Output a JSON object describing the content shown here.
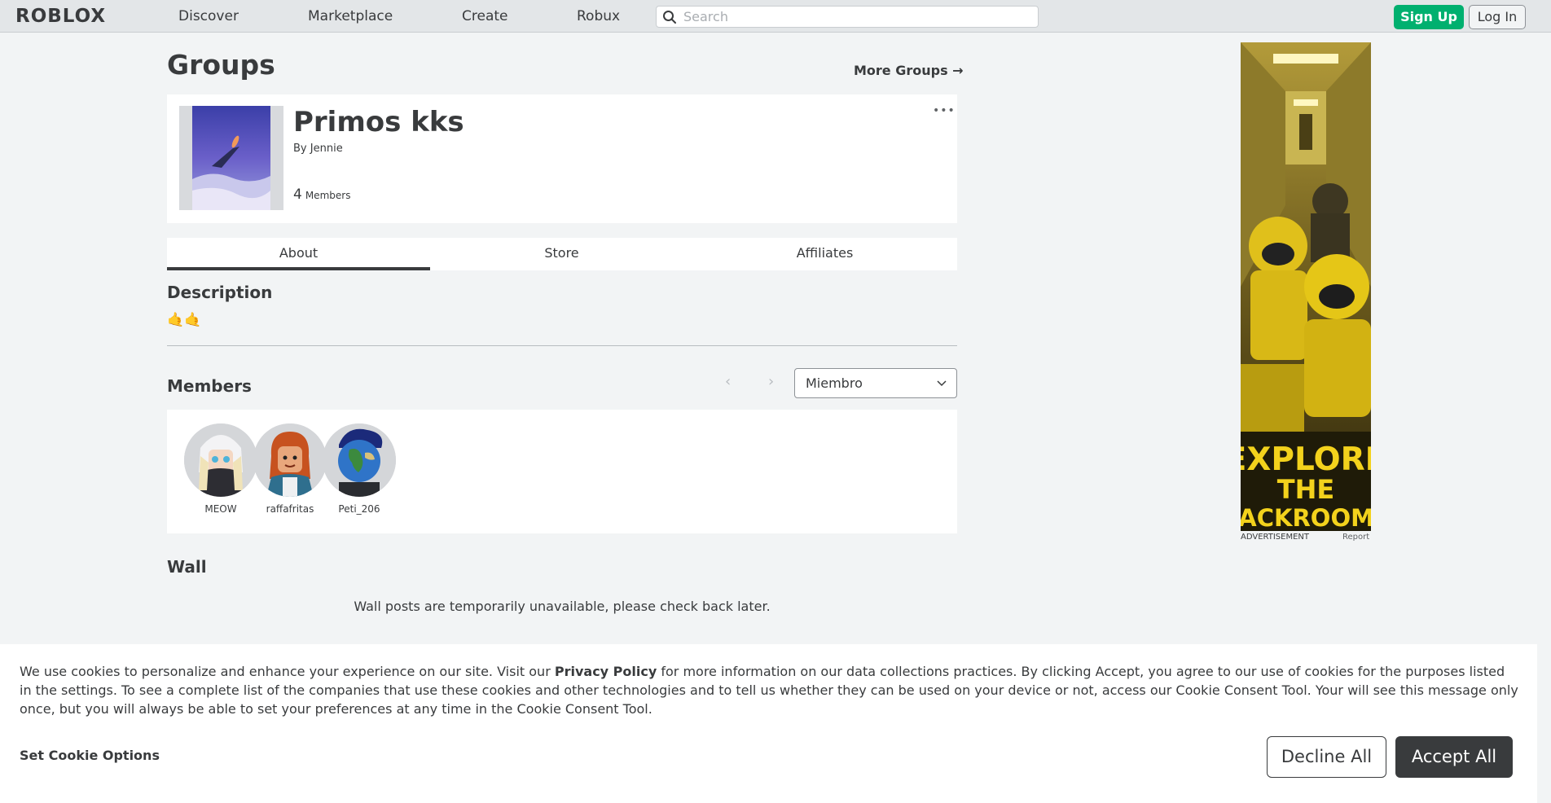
{
  "nav": {
    "logo": "ROBLOX",
    "links": [
      "Discover",
      "Marketplace",
      "Create",
      "Robux"
    ],
    "search_placeholder": "Search",
    "signup_label": "Sign Up",
    "login_label": "Log In"
  },
  "page": {
    "title": "Groups",
    "more_groups": "More Groups →"
  },
  "group": {
    "name": "Primos kks",
    "by_prefix": "By",
    "owner": "Jennie",
    "member_count": "4",
    "member_count_label": "Members",
    "menu_glyph": "•••"
  },
  "tabs": [
    {
      "label": "About",
      "active": true
    },
    {
      "label": "Store",
      "active": false
    },
    {
      "label": "Affiliates",
      "active": false
    }
  ],
  "description": {
    "title": "Description",
    "text": "🤙🤙"
  },
  "members": {
    "title": "Members",
    "prev_glyph": "‹",
    "next_glyph": "›",
    "role_selected": "Miembro",
    "list": [
      {
        "name": "MEOW"
      },
      {
        "name": "raffafritas"
      },
      {
        "name": "Peti_206"
      }
    ]
  },
  "wall": {
    "title": "Wall",
    "message": "Wall posts are temporarily unavailable, please check back later."
  },
  "ad": {
    "headline_1": "EXPLORE",
    "headline_2": "THE",
    "headline_3": "BACKROOMS",
    "caption": "ADVERTISEMENT",
    "report": "Report"
  },
  "cookie": {
    "text_before": "We use cookies to personalize and enhance your experience on our site. Visit our ",
    "privacy_link": "Privacy Policy",
    "text_after": " for more information on our data collections practices. By clicking Accept, you agree to our use of cookies for the purposes listed in the settings. To see a complete list of the companies that use these cookies and other technologies and to tell us whether they can be used on your device or not, access our Cookie Consent Tool. Your will see this message only once, but you will always be able to set your preferences at any time in the Cookie Consent Tool.",
    "set_options": "Set Cookie Options",
    "decline": "Decline All",
    "accept": "Accept All"
  }
}
